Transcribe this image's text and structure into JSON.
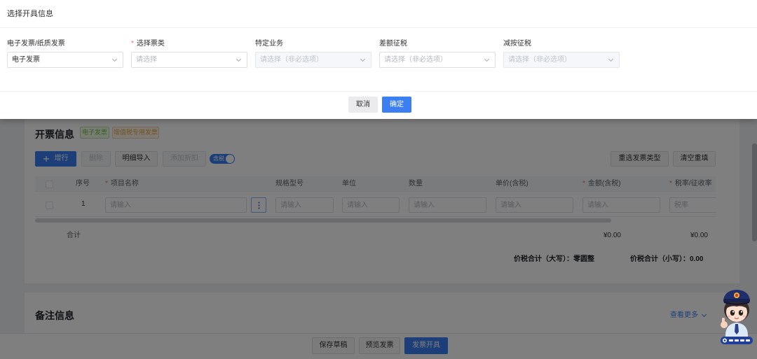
{
  "required_mark": "*",
  "colors": {
    "primary": "#3b7ff3",
    "success": "#67c23a",
    "warning": "#e6a23c",
    "danger": "#f56c6c",
    "mask": "rgba(0,0,0,0.5)"
  },
  "modal": {
    "title": "选择开具信息",
    "fields": [
      {
        "label": "电子发票/纸质发票",
        "required": false,
        "value": "电子发票",
        "disabled": false,
        "icon": "chevron-down-icon"
      },
      {
        "label": "选择票类",
        "required": true,
        "placeholder": "请选择",
        "disabled": false,
        "icon": "chevron-down-icon"
      },
      {
        "label": "特定业务",
        "required": false,
        "placeholder": "请选择（非必选项）",
        "disabled": true,
        "icon": "chevron-down-icon"
      },
      {
        "label": "差额征税",
        "required": false,
        "placeholder": "请选择（非必选项）",
        "disabled": false,
        "icon": "chevron-down-icon"
      },
      {
        "label": "减按征税",
        "required": false,
        "placeholder": "请选择（非必选项）",
        "disabled": true,
        "icon": "chevron-down-icon"
      }
    ],
    "cancel_label": "取消",
    "confirm_label": "确定"
  },
  "invoice_info": {
    "title": "开票信息",
    "badges": [
      {
        "label": "电子发票",
        "color": "#67c23a"
      },
      {
        "label": "增值税专用发票",
        "color": "#e6a23c"
      }
    ],
    "toolbar": {
      "add_row": {
        "label": "增行",
        "icon": "plus-icon"
      },
      "delete": {
        "label": "删除",
        "disabled": true
      },
      "import_details": {
        "label": "明细导入"
      },
      "add_discount": {
        "label": "添加折扣",
        "disabled": true
      },
      "tax_included": {
        "label": "含税",
        "on": true
      },
      "reselect_type": {
        "label": "重选发票类型"
      },
      "clear_refill": {
        "label": "清空重填"
      }
    },
    "table": {
      "columns": [
        {
          "label": "序号",
          "required": false
        },
        {
          "label": "项目名称",
          "required": true
        },
        {
          "label": "规格型号",
          "required": false
        },
        {
          "label": "单位",
          "required": false
        },
        {
          "label": "数量",
          "required": false
        },
        {
          "label": "单价(含税)",
          "required": false
        },
        {
          "label": "金额(含税)",
          "required": true
        },
        {
          "label": "税率/征收率",
          "required": true
        }
      ],
      "rows": [
        {
          "index": "1",
          "picker_icon": "more-vertical-icon",
          "cells": [
            {
              "placeholder": "请输入"
            },
            {
              "placeholder": "请输入"
            },
            {
              "placeholder": "请输入"
            },
            {
              "placeholder": "请输入"
            },
            {
              "placeholder": "请输入"
            },
            {
              "placeholder": "请输入"
            },
            {
              "placeholder": "税率"
            }
          ]
        }
      ],
      "total": {
        "label": "合计",
        "amount": "¥0.00",
        "tax": "¥0.00"
      }
    },
    "summary": {
      "upper_label": "价税合计（大写）：",
      "upper_value": "零圆整",
      "lower_label": "价税合计（小写）：",
      "lower_value": "0.00"
    }
  },
  "remarks": {
    "title": "备注信息",
    "more_label": "查看更多",
    "more_icon": "chevron-down-icon"
  },
  "actions": {
    "save_draft": "保存草稿",
    "preview": "预览发票",
    "issue": "发票开具"
  },
  "assistant": {
    "icon": "assistant-mascot-icon"
  }
}
